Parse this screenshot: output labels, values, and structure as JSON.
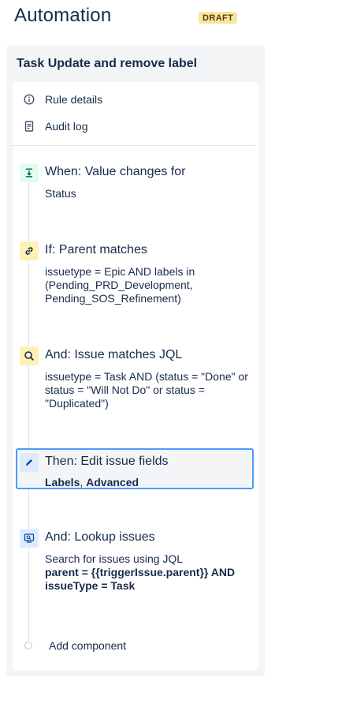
{
  "header": {
    "title": "Automation",
    "badge": "DRAFT"
  },
  "rule": {
    "name": "Task Update and remove label",
    "nav": [
      {
        "label": "Rule details",
        "icon": "info-icon"
      },
      {
        "label": "Audit log",
        "icon": "document-icon"
      }
    ]
  },
  "steps": [
    {
      "title": "When: Value changes for",
      "desc": "Status",
      "icon": "trigger-icon",
      "color": "#e3fcef"
    },
    {
      "title": "If: Parent matches",
      "desc": "issuetype = Epic AND labels in (Pending_PRD_Development, Pending_SOS_Refinement)",
      "icon": "link-icon",
      "color": "#fff0b3"
    },
    {
      "title": "And: Issue matches JQL",
      "desc": "issuetype = Task AND (status = \"Done\" or status = \"Will Not Do\" or status = \"Duplicated\")",
      "icon": "search-icon",
      "color": "#fff0b3"
    },
    {
      "title": "Then: Edit issue fields",
      "desc_bold_1": "Labels",
      "desc_sep": ", ",
      "desc_bold_2": "Advanced",
      "icon": "pencil-icon",
      "color": "#deebff",
      "selected": true
    },
    {
      "title": "And: Lookup issues",
      "desc": "Search for issues using JQL",
      "desc_bold": "parent = {{triggerIssue.parent}} AND issueType = Task",
      "icon": "lookup-icon",
      "color": "#deebff"
    }
  ],
  "add_component": {
    "label": "Add component"
  },
  "colors": {
    "accent": "#4c9aff",
    "text": "#172b4d",
    "panel": "#f4f5f7"
  }
}
